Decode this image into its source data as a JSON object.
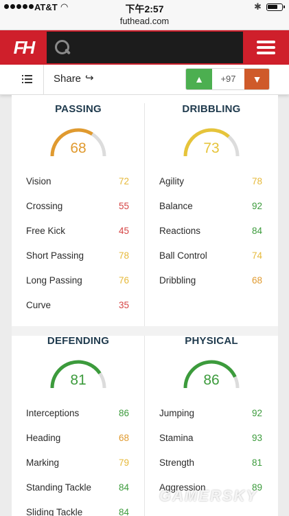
{
  "status_bar": {
    "carrier": "AT&T",
    "time": "下午2:57"
  },
  "browser": {
    "url": "futhead.com"
  },
  "header": {
    "logo_text": "FH"
  },
  "toolbar": {
    "share_label": "Share",
    "vote_count": "+97"
  },
  "colors": {
    "brand_red": "#cf1f2b",
    "rating_green": "#3c9b3c",
    "rating_yellow": "#e6b93a",
    "rating_orange": "#e09a2f",
    "rating_red": "#d64545"
  },
  "categories": [
    {
      "title": "PASSING",
      "value": "68",
      "color": "#e09a2f",
      "stats": [
        {
          "name": "Vision",
          "value": "72",
          "color": "#e6b93a"
        },
        {
          "name": "Crossing",
          "value": "55",
          "color": "#d64545"
        },
        {
          "name": "Free Kick",
          "value": "45",
          "color": "#d64545"
        },
        {
          "name": "Short Passing",
          "value": "78",
          "color": "#e6b93a"
        },
        {
          "name": "Long Passing",
          "value": "76",
          "color": "#e6b93a"
        },
        {
          "name": "Curve",
          "value": "35",
          "color": "#d64545"
        }
      ]
    },
    {
      "title": "DRIBBLING",
      "value": "73",
      "color": "#e6c43a",
      "stats": [
        {
          "name": "Agility",
          "value": "78",
          "color": "#e6b93a"
        },
        {
          "name": "Balance",
          "value": "92",
          "color": "#3c9b3c"
        },
        {
          "name": "Reactions",
          "value": "84",
          "color": "#3c9b3c"
        },
        {
          "name": "Ball Control",
          "value": "74",
          "color": "#e6b93a"
        },
        {
          "name": "Dribbling",
          "value": "68",
          "color": "#e09a2f"
        }
      ]
    },
    {
      "title": "DEFENDING",
      "value": "81",
      "color": "#3c9b3c",
      "stats": [
        {
          "name": "Interceptions",
          "value": "86",
          "color": "#3c9b3c"
        },
        {
          "name": "Heading",
          "value": "68",
          "color": "#e09a2f"
        },
        {
          "name": "Marking",
          "value": "79",
          "color": "#e6b93a"
        },
        {
          "name": "Standing Tackle",
          "value": "84",
          "color": "#3c9b3c"
        },
        {
          "name": "Sliding Tackle",
          "value": "84",
          "color": "#3c9b3c"
        }
      ]
    },
    {
      "title": "PHYSICAL",
      "value": "86",
      "color": "#3c9b3c",
      "stats": [
        {
          "name": "Jumping",
          "value": "92",
          "color": "#3c9b3c"
        },
        {
          "name": "Stamina",
          "value": "93",
          "color": "#3c9b3c"
        },
        {
          "name": "Strength",
          "value": "81",
          "color": "#3c9b3c"
        },
        {
          "name": "Aggression",
          "value": "89",
          "color": "#3c9b3c"
        }
      ]
    }
  ],
  "watermark": "GAMERSKY"
}
